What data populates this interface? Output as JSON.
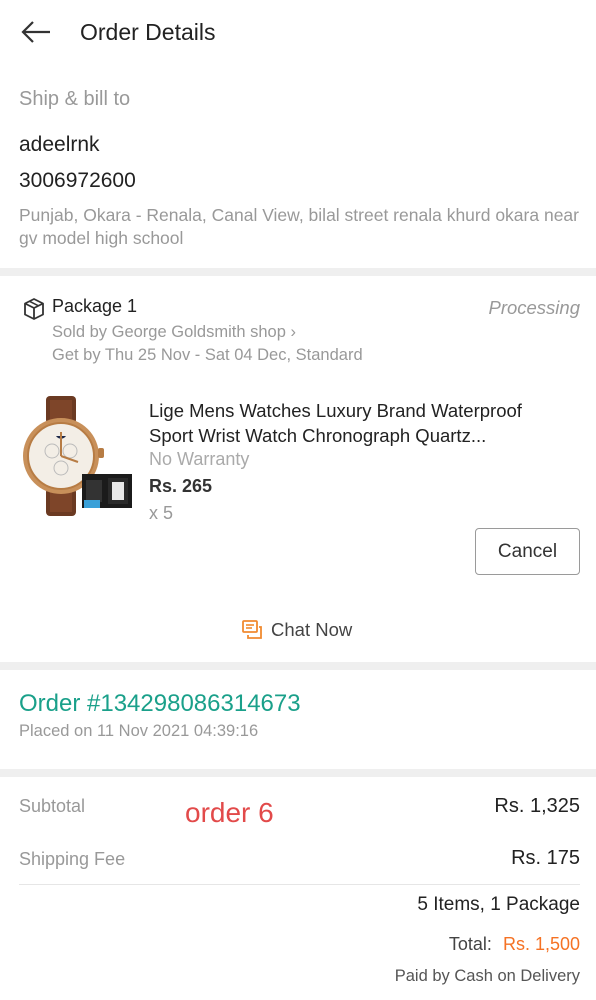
{
  "header": {
    "title": "Order Details",
    "back_icon": "arrow-left-icon"
  },
  "shipping": {
    "heading": "Ship & bill to",
    "name": "adeelrnk",
    "phone": "3006972600",
    "address": "Punjab, Okara - Renala, Canal View, bilal street renala khurd okara near gv model high school"
  },
  "package": {
    "label": "Package 1",
    "status": "Processing",
    "sold_by": "Sold by George Goldsmith shop ›",
    "delivery": "Get by Thu 25 Nov - Sat 04 Dec, Standard",
    "icon": "package-box-icon",
    "item": {
      "title": "Lige Mens Watches Luxury Brand Waterproof Sport Wrist Watch Chronograph Quartz...",
      "warranty": "No Warranty",
      "price": "Rs. 265",
      "quantity": "x 5"
    },
    "cancel_label": "Cancel",
    "chat_label": "Chat Now"
  },
  "order": {
    "number": "Order #134298086314673",
    "placed": "Placed on 11 Nov 2021  04:39:16"
  },
  "summary": {
    "subtotal_label": "Subtotal",
    "subtotal_value": "Rs. 1,325",
    "annotation": "order 6",
    "shipping_label": "Shipping Fee",
    "shipping_value": "Rs. 175",
    "items_count": "5 Items, 1 Package",
    "total_label": "Total:",
    "total_value": "Rs. 1,500",
    "payment": "Paid by Cash on Delivery"
  },
  "colors": {
    "accent_teal": "#1aa08a",
    "accent_orange": "#f57224",
    "annotation_red": "#e24a4a"
  }
}
